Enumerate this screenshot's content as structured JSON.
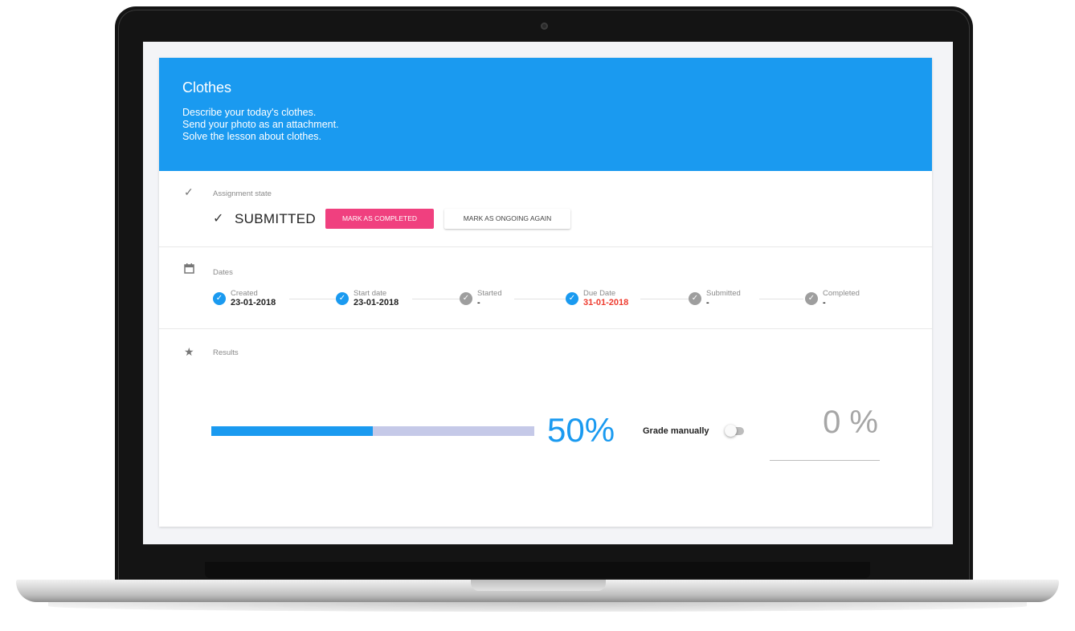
{
  "header": {
    "title": "Clothes",
    "description": [
      "Describe your today's clothes.",
      "Send your photo as an attachment.",
      "Solve the lesson about clothes."
    ]
  },
  "assignment_state": {
    "label": "Assignment state",
    "status": "SUBMITTED",
    "mark_completed_label": "MARK AS COMPLETED",
    "mark_ongoing_label": "MARK AS ONGOING AGAIN"
  },
  "dates": {
    "label": "Dates",
    "steps": [
      {
        "label": "Created",
        "value": "23-01-2018",
        "done": true
      },
      {
        "label": "Start date",
        "value": "23-01-2018",
        "done": true
      },
      {
        "label": "Started",
        "value": "-",
        "done": false
      },
      {
        "label": "Due Date",
        "value": "31-01-2018",
        "done": true,
        "overdue": true
      },
      {
        "label": "Submitted",
        "value": "-",
        "done": false
      },
      {
        "label": "Completed",
        "value": "-",
        "done": false
      }
    ]
  },
  "results": {
    "label": "Results",
    "progress_percent": 50,
    "progress_text": "50%",
    "grade_manually_label": "Grade manually",
    "grade_manually_enabled": false,
    "grade_value": "0 %"
  },
  "colors": {
    "primary": "#1a9af0",
    "accent": "#f0407f",
    "overdue": "#ee3b2e",
    "progress_track": "#c5c9e8"
  }
}
